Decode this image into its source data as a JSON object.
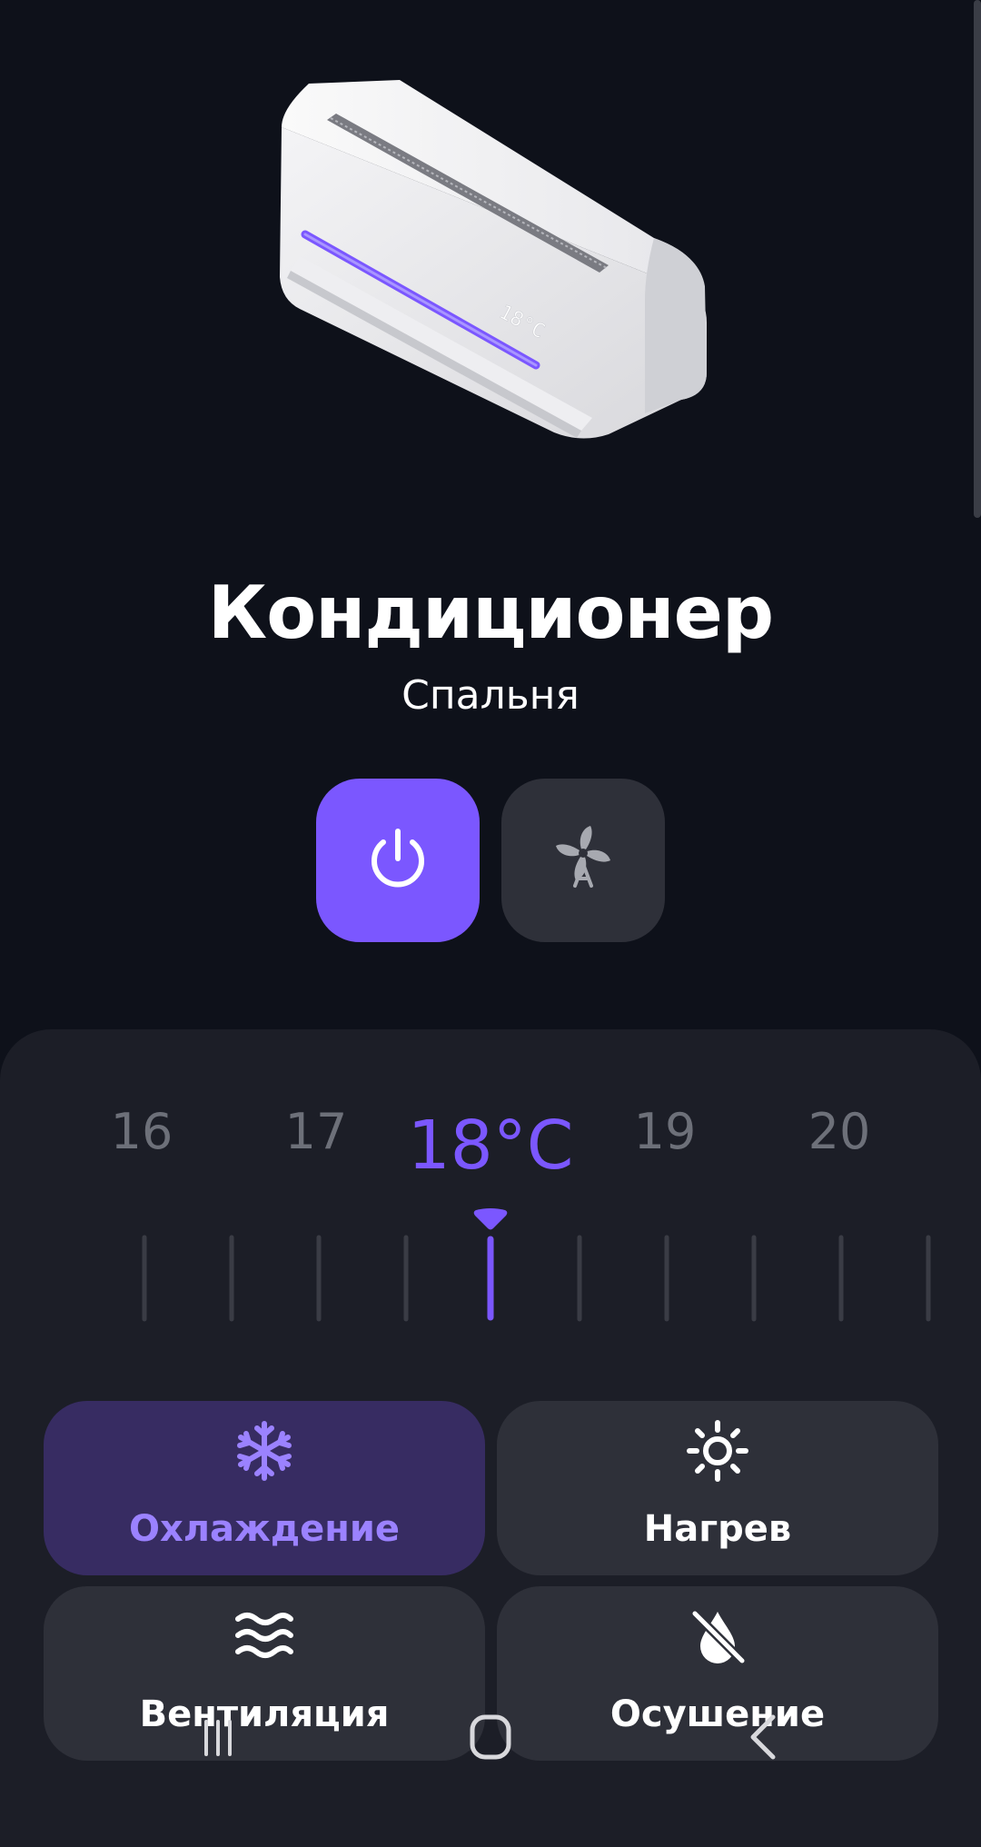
{
  "device": {
    "name": "Кондиционер",
    "room": "Спальня",
    "display_temp": "18°C"
  },
  "quick_actions": [
    {
      "icon": "power-icon",
      "active": true
    },
    {
      "icon": "fan-auto-icon",
      "active": false
    }
  ],
  "temperature": {
    "unit": "°C",
    "current": 18,
    "current_label": "18°C",
    "labels": [
      "16",
      "17",
      "19",
      "20"
    ]
  },
  "modes": [
    {
      "label": "Охлаждение",
      "icon": "snowflake-icon",
      "active": true
    },
    {
      "label": "Нагрев",
      "icon": "sun-icon",
      "active": false
    },
    {
      "label": "Вентиляция",
      "icon": "wind-waves-icon",
      "active": false
    },
    {
      "label": "Осушение",
      "icon": "no-drop-icon",
      "active": false
    }
  ],
  "colors": {
    "background": "#0e111a",
    "panel": "#1c1e27",
    "card": "#2e3039",
    "accent": "#7b57ff",
    "active_card": "#372c62",
    "active_text": "#9b82ff"
  }
}
